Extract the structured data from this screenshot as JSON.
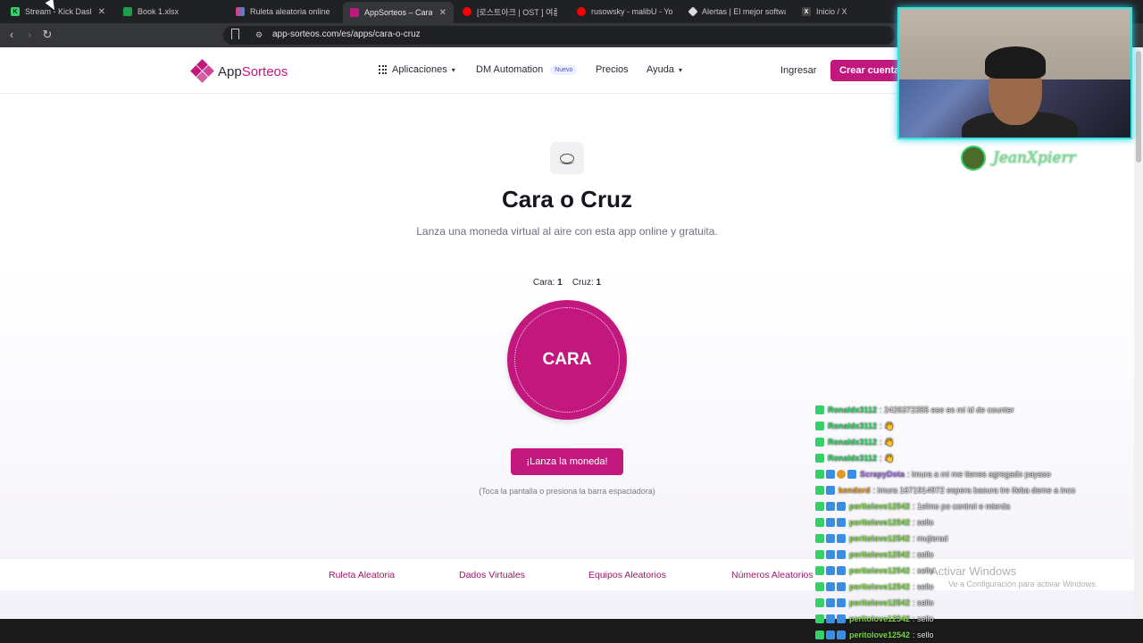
{
  "browser": {
    "tabs": [
      {
        "label": "Stream - Kick Dash",
        "fav_color": "#35d06a",
        "fav": "K"
      },
      {
        "label": "Book 1.xlsx",
        "fav_color": "#1e9e4a",
        "fav": ""
      },
      {
        "label": "Ruleta aleatoria online – n",
        "fav_color": "#e03a7a",
        "fav": ""
      },
      {
        "label": "AppSorteos – Cara",
        "fav_color": "#c2187d",
        "fav": ""
      },
      {
        "label": "[로스트아크 | OST ] 여름곧",
        "fav_color": "#ff0000",
        "fav": ""
      },
      {
        "label": "rusowsky - malibU - YouTu",
        "fav_color": "#ff0000",
        "fav": ""
      },
      {
        "label": "Alertas | El mejor software",
        "fav_color": "#dddddd",
        "fav": ""
      },
      {
        "label": "Inicio / X",
        "fav_color": "#444444",
        "fav": "X"
      }
    ],
    "url": "app-sorteos.com/es/apps/cara-o-cruz"
  },
  "site": {
    "logo_prefix": "App",
    "logo_suffix": "Sorteos",
    "nav": {
      "apps": "Aplicaciones",
      "dm": "DM Automation",
      "dm_badge": "Nuevo",
      "prices": "Precios",
      "help": "Ayuda"
    },
    "login": "Ingresar",
    "signup": "Crear cuenta"
  },
  "main": {
    "title": "Cara o Cruz",
    "subtitle": "Lanza una moneda virtual al aire con esta app online y gratuita.",
    "score_cara_label": "Cara:",
    "score_cara_value": "1",
    "score_cruz_label": "Cruz:",
    "score_cruz_value": "1",
    "coin_face": "CARA",
    "flip_button": "¡Lanza la moneda!",
    "hint": "(Toca la pantalla o presiona la barra espaciadora)"
  },
  "footer_links": [
    "Ruleta Aleatoria",
    "Dados Virtuales",
    "Equipos Aleatorios",
    "Números Aleatorios"
  ],
  "stream": {
    "streamer_name": "JeanXpierr",
    "chat": [
      {
        "user": "Ronaldx3112",
        "color": "#35d06a",
        "badges": [
          "k"
        ],
        "msg": "2426372355 ese es mi id de counter"
      },
      {
        "user": "Ronaldx3112",
        "color": "#35d06a",
        "badges": [
          "k"
        ],
        "msg": "👋"
      },
      {
        "user": "Ronaldx3112",
        "color": "#35d06a",
        "badges": [
          "k"
        ],
        "msg": "👋"
      },
      {
        "user": "Ronaldx3112",
        "color": "#35d06a",
        "badges": [
          "k"
        ],
        "msg": "👋"
      },
      {
        "user": "ScrapyDota",
        "color": "#a070e0",
        "badges": [
          "k",
          "s",
          "o",
          "s"
        ],
        "msg": "imura a mi me tienes agregado payaso"
      },
      {
        "user": "kendord",
        "color": "#e09a2a",
        "badges": [
          "k",
          "s"
        ],
        "msg": "imura 1671914972 espera basura tre ifeba deme a inco"
      },
      {
        "user": "peritolove12542",
        "color": "#7fd64a",
        "badges": [
          "k",
          "s",
          "s"
        ],
        "msg": "1elmo po control e mierda"
      },
      {
        "user": "peritolove12542",
        "color": "#7fd64a",
        "badges": [
          "k",
          "s",
          "s"
        ],
        "msg": "sello"
      },
      {
        "user": "peritolove12542",
        "color": "#7fd64a",
        "badges": [
          "k",
          "s",
          "s"
        ],
        "msg": "mujierad"
      },
      {
        "user": "peritolove12542",
        "color": "#7fd64a",
        "badges": [
          "k",
          "s",
          "s"
        ],
        "msg": "sello"
      },
      {
        "user": "peritolove12542",
        "color": "#7fd64a",
        "badges": [
          "k",
          "s",
          "s"
        ],
        "msg": "sello"
      },
      {
        "user": "peritolove12542",
        "color": "#7fd64a",
        "badges": [
          "k",
          "s",
          "s"
        ],
        "msg": "sello"
      },
      {
        "user": "peritolove12542",
        "color": "#7fd64a",
        "badges": [
          "k",
          "s",
          "s"
        ],
        "msg": "sello"
      },
      {
        "user": "peritolove12542",
        "color": "#7fd64a",
        "badges": [
          "k",
          "s",
          "s"
        ],
        "msg": "sello"
      },
      {
        "user": "peritolove12542",
        "color": "#7fd64a",
        "badges": [
          "k",
          "s",
          "s"
        ],
        "msg": "sello"
      }
    ]
  },
  "os": {
    "activate_title": "Activar Windows",
    "activate_sub": "Ve a Configuración para activar Windows."
  },
  "colors": {
    "brand": "#c2187d",
    "accent_cyan": "#2ee6e0"
  }
}
